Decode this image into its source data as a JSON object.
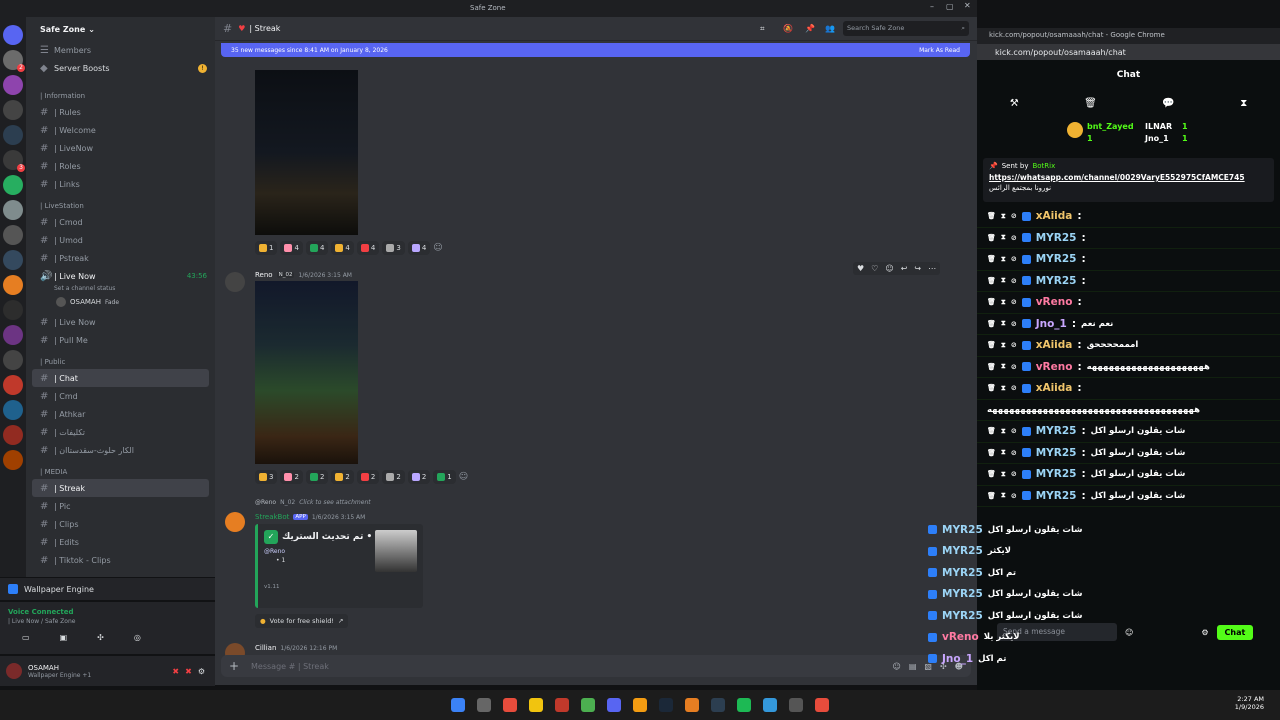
{
  "window": {
    "title": "Safe Zone"
  },
  "server": {
    "name": "Safe Zone",
    "members": "Members",
    "boosts": "Server Boosts",
    "boost_badge": "!"
  },
  "categories": {
    "information": "| Information",
    "livestation": "| LiveStation",
    "public": "| Public",
    "media": "| MEDIA"
  },
  "info_channels": [
    "| Rules",
    "| Welcome",
    "| LiveNow",
    "| Roles",
    "| Links"
  ],
  "live_channels": [
    "| Cmod",
    "| Umod",
    "| Pstreak"
  ],
  "voice": {
    "name": "| Live Now",
    "timer": "43:56",
    "status": "Set a channel status",
    "user": "OSAMAH",
    "user_tag": "Fade"
  },
  "voice2": [
    "| Live Now",
    "| Pull Me"
  ],
  "public_channels": [
    "| Chat",
    "| Cmd",
    "| Athkar",
    "| تكليفات",
    "| الكار حلوث-سقدستاان"
  ],
  "media_channels": [
    "| Streak",
    "| Pic",
    "| Clips",
    "| Edits",
    "| Tiktok - Clips"
  ],
  "wallpaper": "Wallpaper Engine",
  "voice_connected": {
    "label": "Voice Connected",
    "sub": "| Live Now / Safe Zone"
  },
  "user": {
    "name": "OSAMAH",
    "status": "Wallpaper Engine +1"
  },
  "channel_header": {
    "name": "| Streak",
    "search": "Search Safe Zone"
  },
  "banner": {
    "text": "35 new messages since 8:41 AM on January 8, 2026",
    "action": "Mark As Read"
  },
  "reactions1": [
    "1",
    "4",
    "4",
    "4",
    "4",
    "3",
    "4"
  ],
  "message2": {
    "author": "Reno",
    "tag": "N_02",
    "time": "1/6/2026 3:15 AM"
  },
  "reactions2": [
    "3",
    "2",
    "2",
    "2",
    "2",
    "2",
    "2",
    "1"
  ],
  "reply": {
    "author": "@Reno",
    "tag": "N_02",
    "text": "Click to see attachment"
  },
  "bot": {
    "name": "StreakBot",
    "badge": "APP",
    "time": "1/6/2026 3:15 AM",
    "title": "تم تحديث الستريك •",
    "mention": "@Reno",
    "line1": "• 1",
    "version": "v1.11",
    "vote": "Vote for free shield!"
  },
  "next": {
    "author": "Cillian",
    "time": "1/6/2026 12:16 PM"
  },
  "composer": {
    "placeholder": "Message # | Streak"
  },
  "browser": {
    "title": "kick.com/popout/osamaaah/chat - Google Chrome",
    "url": "kick.com/popout/osamaaah/chat"
  },
  "kick": {
    "title": "Chat",
    "top_users": [
      "bnt_Zayed",
      "ILNAR",
      "Jno_1"
    ],
    "top_counts": [
      "1",
      "1",
      "1"
    ],
    "pinned_by": "Sent by",
    "bot": "BotRix",
    "link": "https://whatsapp.com/channel/0029VaryE552975CfAMCE745",
    "pinned_text": "نورونا بمجتمع الرائس",
    "messages": [
      {
        "user": "xAiida",
        "text": "",
        "color": "#f0c56b"
      },
      {
        "user": "MYR25",
        "text": "",
        "color": "#9bd4f5"
      },
      {
        "user": "MYR25",
        "text": "",
        "color": "#9bd4f5"
      },
      {
        "user": "MYR25",
        "text": "",
        "color": "#9bd4f5"
      },
      {
        "user": "vReno",
        "text": "",
        "color": "#ff7aa2"
      },
      {
        "user": "Jno_1",
        "text": "نعم نعم",
        "color": "#c9a7ff"
      },
      {
        "user": "xAiida",
        "text": "امممححححق",
        "color": "#f0c56b"
      },
      {
        "user": "vReno",
        "text": "هههههههههههههههههههههه",
        "color": "#ff7aa2"
      },
      {
        "user": "xAiida",
        "text": "",
        "color": "#f0c56b"
      },
      {
        "user": "",
        "text": "هههههههههههههههههههههههههههههههههههههه",
        "color": "#fff"
      },
      {
        "user": "MYR25",
        "text": "شات يقلون ارسلو اكل",
        "color": "#9bd4f5"
      },
      {
        "user": "MYR25",
        "text": "شات يقلون ارسلو اكل",
        "color": "#9bd4f5"
      },
      {
        "user": "MYR25",
        "text": "شات يقلون ارسلو اكل",
        "color": "#9bd4f5"
      },
      {
        "user": "MYR25",
        "text": "شات يقلون ارسلو اكل",
        "color": "#9bd4f5"
      }
    ],
    "overlay": [
      {
        "user": "MYR25",
        "text": "شات يقلون ارسلو اكل"
      },
      {
        "user": "MYR25",
        "text": "لايكثر"
      },
      {
        "user": "MYR25",
        "text": "تم اكل"
      },
      {
        "user": "MYR25",
        "text": "شات يقلون ارسلو اكل"
      },
      {
        "user": "MYR25",
        "text": "شات يقلون ارسلو اكل"
      },
      {
        "user": "vReno",
        "text": "لايكثر يلا"
      },
      {
        "user": "Jno_1",
        "text": "تم اكل"
      }
    ],
    "send_placeholder": "Send a message",
    "send": "Chat"
  },
  "taskbar": {
    "time": "2:27 AM",
    "date": "1/9/2026"
  }
}
